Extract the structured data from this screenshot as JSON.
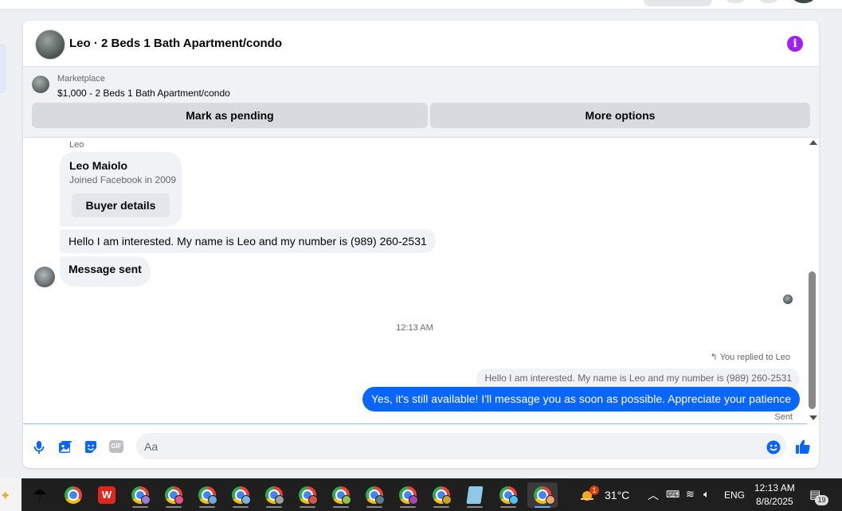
{
  "header": {
    "title": "Leo · 2 Beds 1 Bath Apartment/condo",
    "info_icon": "info-icon"
  },
  "marketplace": {
    "label": "Marketplace",
    "listing": "$1,000 - 2 Beds 1 Bath Apartment/condo",
    "mark_pending_label": "Mark as pending",
    "more_options_label": "More options"
  },
  "thread": {
    "sender_label": "Leo",
    "profile_card": {
      "name": "Leo Maiolo",
      "joined": "Joined Facebook in 2009",
      "buyer_details_label": "Buyer details"
    },
    "incoming": [
      "Hello I am interested. My name is Leo and my number is (989) 260-2531",
      "Message sent"
    ],
    "timestamp": "12:13 AM",
    "replied_label": "You replied to Leo",
    "quoted_message": "Hello I am interested. My name is Leo and my number is (989) 260-2531",
    "outgoing": "Yes, it's still available! I'll message you as soon as possible. Appreciate your patience",
    "status": "Sent"
  },
  "composer": {
    "placeholder": "Aa",
    "icons": [
      "microphone-icon",
      "photo-icon",
      "sticker-icon",
      "gif-icon",
      "emoji-icon",
      "thumbs-up-icon"
    ],
    "gif_text": "GIF"
  },
  "colors": {
    "accent": "#0866ff",
    "info": "#a020f0",
    "bubble_in": "#f0f2f5"
  },
  "taskbar": {
    "weather_alert_count": "1",
    "temperature": "31°C",
    "language": "ENG",
    "time": "12:13 AM",
    "date": "8/8/2025",
    "notification_count": "19"
  }
}
